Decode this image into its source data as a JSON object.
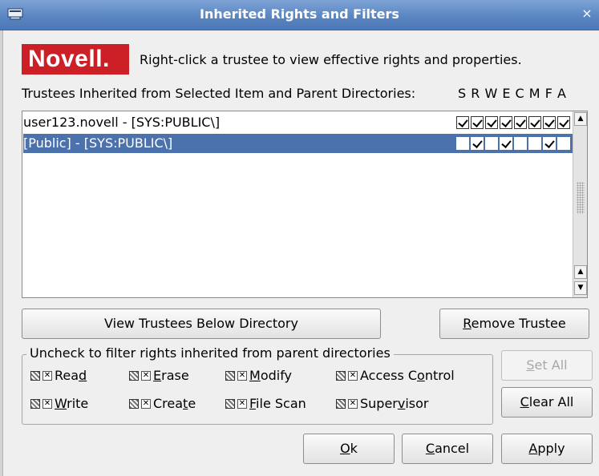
{
  "window": {
    "title": "Inherited Rights and Filters",
    "close_glyph": "×"
  },
  "brand": {
    "logo_text": "Novell",
    "logo_dot": "."
  },
  "hint": "Right-click a trustee to view effective rights and properties.",
  "trustees": {
    "header": "Trustees Inherited from Selected Item and Parent Directories:",
    "rights_letters": "S R W E C M F A",
    "rows": [
      {
        "name": "user123.novell - [SYS:PUBLIC\\]",
        "rights": [
          true,
          true,
          true,
          true,
          true,
          true,
          true,
          true
        ],
        "selected": false
      },
      {
        "name": "[Public] - [SYS:PUBLIC\\]",
        "rights": [
          false,
          true,
          false,
          true,
          false,
          false,
          true,
          false
        ],
        "selected": true
      }
    ]
  },
  "buttons": {
    "view_trustees": "View Trustees Below Directory",
    "remove_trustee_pre": "",
    "remove_trustee_ul": "R",
    "remove_trustee_post": "emove Trustee",
    "set_all_pre": "",
    "set_all_ul": "S",
    "set_all_post": "et All",
    "clear_all_pre": "",
    "clear_all_ul": "C",
    "clear_all_post": "lear All",
    "ok_ul": "O",
    "ok_post": "k",
    "cancel_ul": "C",
    "cancel_post": "ancel",
    "apply_ul": "A",
    "apply_post": "pply"
  },
  "filters": {
    "legend": "Uncheck to filter rights inherited from parent directories",
    "items": [
      {
        "pre": "Rea",
        "ul": "d",
        "post": ""
      },
      {
        "pre": "",
        "ul": "E",
        "post": "rase"
      },
      {
        "pre": "",
        "ul": "M",
        "post": "odify"
      },
      {
        "pre": "Access C",
        "ul": "o",
        "post": "ntrol"
      },
      {
        "pre": "",
        "ul": "W",
        "post": "rite"
      },
      {
        "pre": "Crea",
        "ul": "t",
        "post": "e"
      },
      {
        "pre": "",
        "ul": "F",
        "post": "ile Scan"
      },
      {
        "pre": "Super",
        "ul": "v",
        "post": "isor"
      }
    ]
  },
  "colors": {
    "titlebar": "#5a86c2",
    "selection": "#4b72ad",
    "novell_red": "#cc1f26"
  }
}
